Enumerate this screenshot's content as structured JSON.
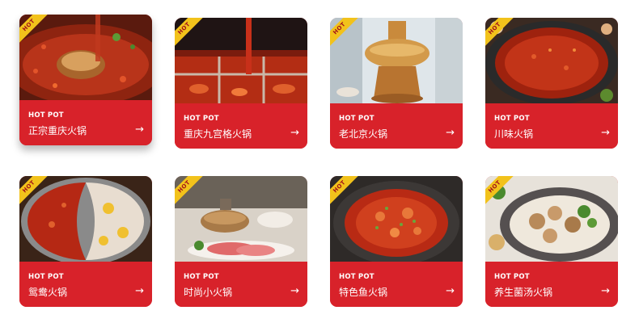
{
  "cards": [
    {
      "badge": "HOT",
      "tag": "HOT POT",
      "title": "正宗重庆火锅",
      "arrow": "→"
    },
    {
      "badge": "HOT",
      "tag": "HOT POT",
      "title": "重庆九宫格火锅",
      "arrow": "→"
    },
    {
      "badge": "HOT",
      "tag": "HOT POT",
      "title": "老北京火锅",
      "arrow": "→"
    },
    {
      "badge": "HOT",
      "tag": "HOT POT",
      "title": "川味火锅",
      "arrow": "→"
    },
    {
      "badge": "HOT",
      "tag": "HOT POT",
      "title": "鸳鸯火锅",
      "arrow": "→"
    },
    {
      "badge": "HOT",
      "tag": "HOT POT",
      "title": "时尚小火锅",
      "arrow": "→"
    },
    {
      "badge": "HOT",
      "tag": "HOT POT",
      "title": "特色鱼火锅",
      "arrow": "→"
    },
    {
      "badge": "HOT",
      "tag": "HOT POT",
      "title": "养生菌汤火锅",
      "arrow": "→"
    }
  ],
  "colors": {
    "card_red": "#d8222a",
    "badge_yellow": "#f2c21b",
    "text": "#ffffff"
  }
}
